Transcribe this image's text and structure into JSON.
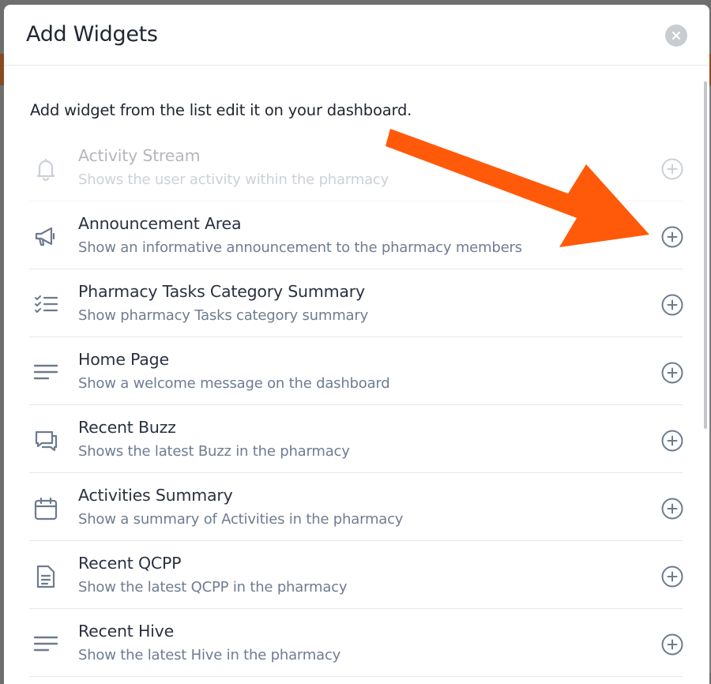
{
  "modal": {
    "title": "Add Widgets",
    "intro": "Add widget from the list edit it on your dashboard."
  },
  "colors": {
    "accent_arrow": "#ff5a0a",
    "icon": "#6d7a8f",
    "title_text": "#2b3140",
    "desc_text": "#6f7c92"
  },
  "widgets": [
    {
      "title": "Activity Stream",
      "description": "Shows the user activity within the pharmacy",
      "icon": "bell-icon",
      "disabled": true
    },
    {
      "title": "Announcement Area",
      "description": "Show an informative announcement to the pharmacy members",
      "icon": "megaphone-icon",
      "disabled": false
    },
    {
      "title": "Pharmacy Tasks Category Summary",
      "description": "Show pharmacy Tasks category summary",
      "icon": "checklist-icon",
      "disabled": false
    },
    {
      "title": "Home Page",
      "description": "Show a welcome message on the dashboard",
      "icon": "lines-icon",
      "disabled": false
    },
    {
      "title": "Recent Buzz",
      "description": "Shows the latest Buzz in the pharmacy",
      "icon": "chat-icon",
      "disabled": false
    },
    {
      "title": "Activities Summary",
      "description": "Show a summary of Activities in the pharmacy",
      "icon": "calendar-icon",
      "disabled": false
    },
    {
      "title": "Recent QCPP",
      "description": "Show the latest QCPP in the pharmacy",
      "icon": "document-icon",
      "disabled": false
    },
    {
      "title": "Recent Hive",
      "description": "Show the latest Hive in the pharmacy",
      "icon": "lines-icon",
      "disabled": false
    }
  ]
}
